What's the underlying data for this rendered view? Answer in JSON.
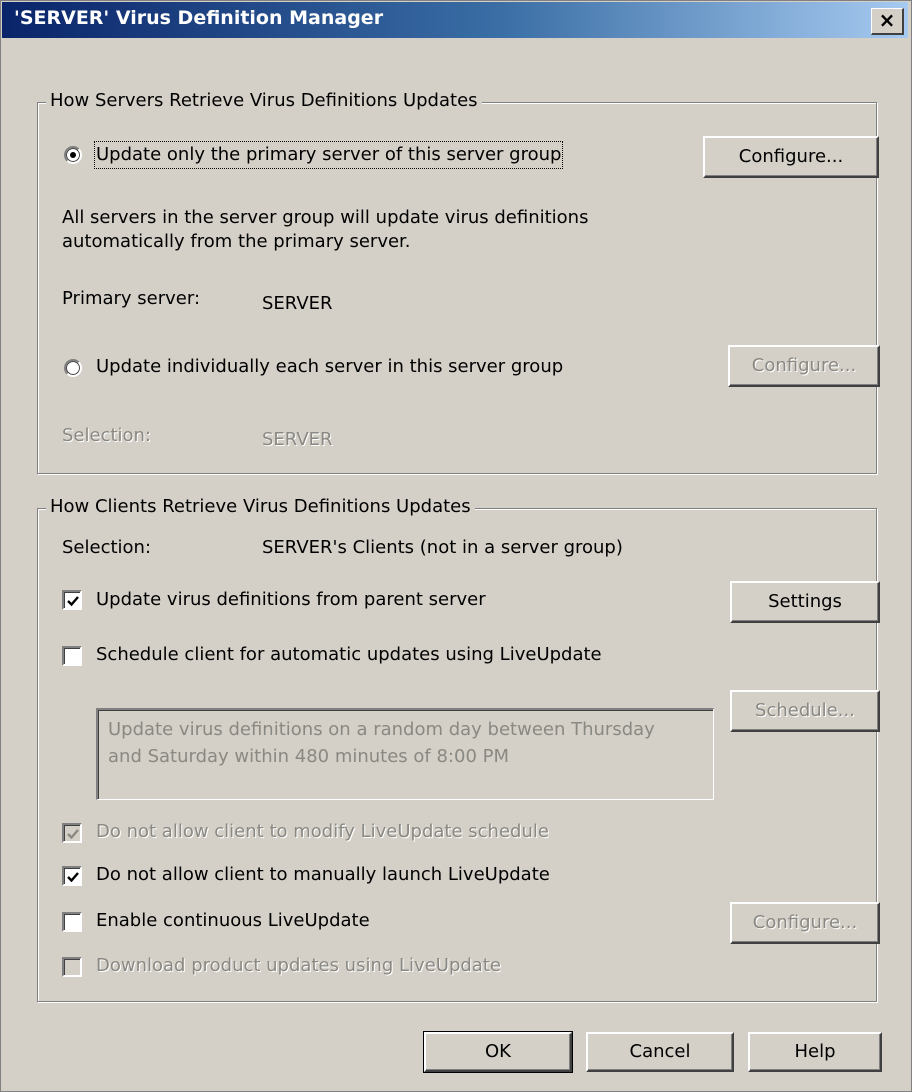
{
  "window": {
    "title": "'SERVER' Virus Definition Manager",
    "close_glyph": "×"
  },
  "servers_group": {
    "legend": "How Servers Retrieve Virus Definitions Updates",
    "option_primary": "Update only the primary server of this server group",
    "configure_primary": "Configure...",
    "description_line1": "All servers in the server group will update virus definitions",
    "description_line2": "automatically from the primary server.",
    "primary_server_label": "Primary server:",
    "primary_server_value": "SERVER",
    "option_individual": "Update individually each server in this server group",
    "configure_individual": "Configure...",
    "selection_label": "Selection:",
    "selection_value": "SERVER"
  },
  "clients_group": {
    "legend": "How Clients Retrieve Virus Definitions Updates",
    "selection_label": "Selection:",
    "selection_value": "SERVER's Clients (not in a server group)",
    "update_from_parent": "Update virus definitions from parent server",
    "settings_button": "Settings",
    "schedule_liveupdate": "Schedule client for automatic updates using LiveUpdate",
    "schedule_button": "Schedule...",
    "schedule_text": "Update virus definitions on a random day between Thursday and Saturday within 480 minutes of 8:00 PM",
    "schedule_text_line1": "Update virus definitions on a random day between Thursday",
    "schedule_text_line2": "and Saturday within 480 minutes of 8:00 PM",
    "no_modify_schedule": "Do not allow client to modify LiveUpdate schedule",
    "no_manual_launch": "Do not allow client to manually launch LiveUpdate",
    "continuous_liveupdate": "Enable continuous LiveUpdate",
    "configure_continuous": "Configure...",
    "download_product_updates": "Download product updates using LiveUpdate"
  },
  "states": {
    "radio_primary_selected": true,
    "radio_individual_selected": false,
    "update_from_parent_checked": true,
    "schedule_liveupdate_checked": false,
    "no_modify_schedule_checked": true,
    "no_manual_launch_checked": true,
    "continuous_liveupdate_checked": false,
    "download_product_updates_checked": false
  },
  "footer": {
    "ok": "OK",
    "cancel": "Cancel",
    "help": "Help"
  }
}
